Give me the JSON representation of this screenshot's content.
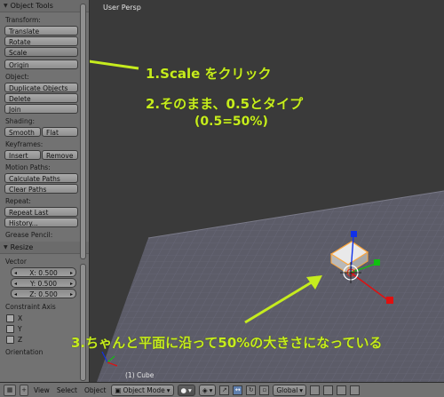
{
  "shelf": {
    "title": "Object Tools",
    "sections": {
      "transform": "Transform:",
      "object": "Object:",
      "shading": "Shading:",
      "keyframes": "Keyframes:",
      "motion_paths": "Motion Paths:",
      "repeat": "Repeat:",
      "grease_pencil": "Grease Pencil:"
    },
    "buttons": {
      "translate": "Translate",
      "rotate": "Rotate",
      "scale": "Scale",
      "origin": "Origin",
      "duplicate_objects": "Duplicate Objects",
      "delete": "Delete",
      "join": "Join",
      "smooth": "Smooth",
      "flat": "Flat",
      "insert": "Insert",
      "remove": "Remove",
      "calculate_paths": "Calculate Paths",
      "clear_paths": "Clear Paths",
      "repeat_last": "Repeat Last",
      "history": "History..."
    },
    "resize": {
      "title": "Resize",
      "vector_label": "Vector",
      "x": "X: 0.500",
      "y": "Y: 0.500",
      "z": "Z: 0.500",
      "constraint_label": "Constraint Axis",
      "axes": [
        "X",
        "Y",
        "Z"
      ],
      "orientation_label": "Orientation"
    }
  },
  "viewport": {
    "title": "User Persp",
    "object_label": "(1) Cube",
    "colors": {
      "x_axis": "#e01010",
      "y_axis": "#10c010",
      "z_axis": "#1030e8",
      "grid": "#6c6c7e"
    }
  },
  "annotations": {
    "step1": "1.Scale をクリック",
    "step2": "2.そのまま、0.5とタイプ",
    "step2b": "(0.5=50%)",
    "step3": "3.ちゃんと平面に沿って50%の大きさになっている",
    "color": "#c6ec1e"
  },
  "header": {
    "view": "View",
    "select": "Select",
    "object": "Object",
    "mode": "Object Mode",
    "orientation": "Global"
  }
}
